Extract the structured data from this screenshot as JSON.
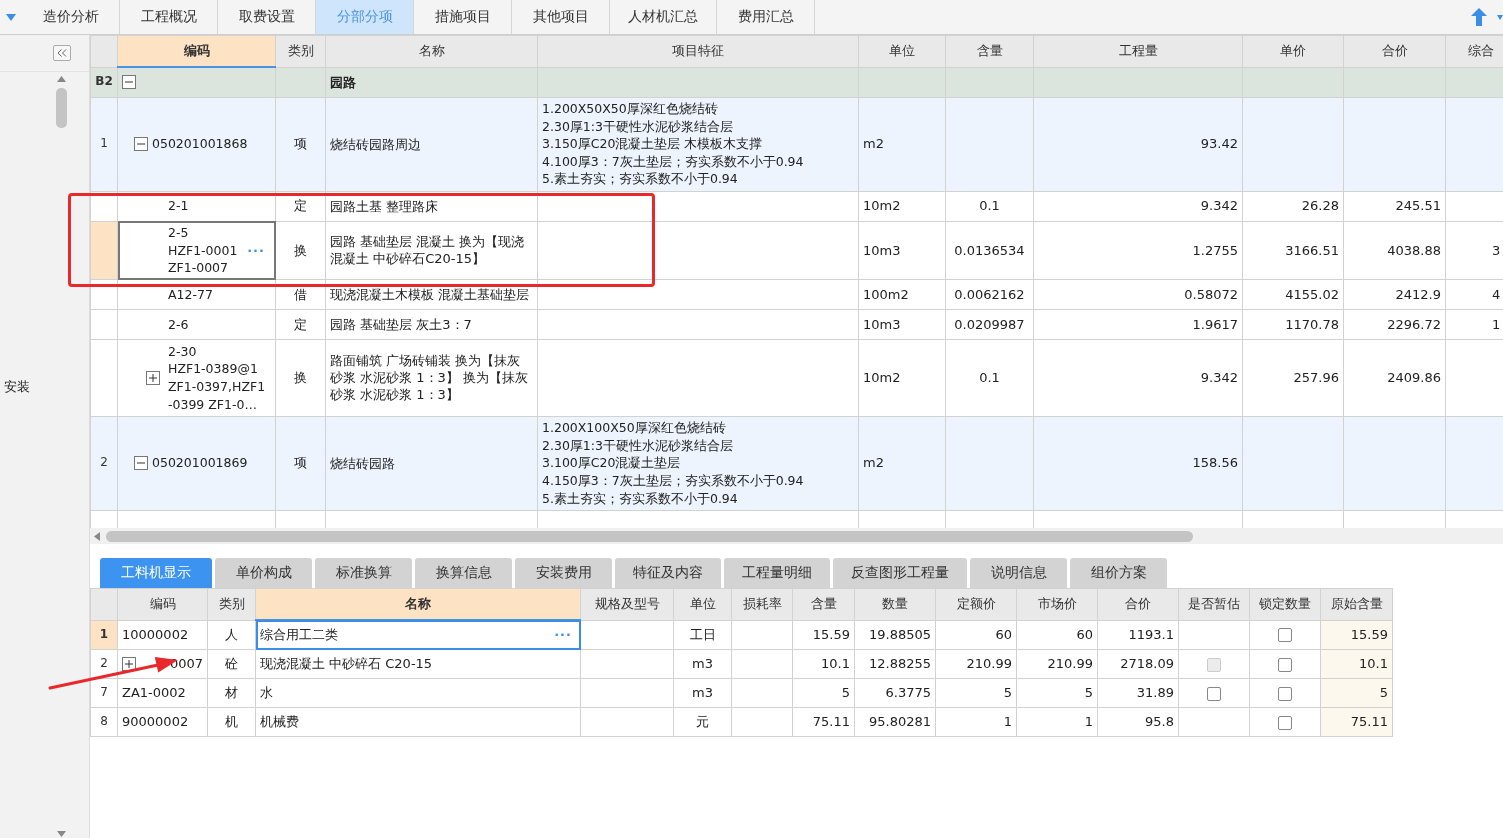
{
  "top_tabs": [
    {
      "label": "造价分析",
      "selected": false
    },
    {
      "label": "工程概况",
      "selected": false
    },
    {
      "label": "取费设置",
      "selected": false
    },
    {
      "label": "分部分项",
      "selected": true
    },
    {
      "label": "措施项目",
      "selected": false
    },
    {
      "label": "其他项目",
      "selected": false
    },
    {
      "label": "人材机汇总",
      "selected": false
    },
    {
      "label": "费用汇总",
      "selected": false
    }
  ],
  "side_panel": {
    "label": "安装"
  },
  "main_table": {
    "columns": [
      {
        "label": "编码",
        "selected": true
      },
      {
        "label": "类别",
        "selected": false
      },
      {
        "label": "名称",
        "selected": false
      },
      {
        "label": "项目特征",
        "selected": false
      },
      {
        "label": "单位",
        "selected": false
      },
      {
        "label": "含量",
        "selected": false
      },
      {
        "label": "工程量",
        "selected": false
      },
      {
        "label": "单价",
        "selected": false
      },
      {
        "label": "合价",
        "selected": false
      },
      {
        "label": "综合",
        "selected": false
      }
    ],
    "rows": [
      {
        "kind": "section",
        "number": "B2",
        "name": "园路",
        "expanded": true,
        "selected": false,
        "children": [
          {
            "kind": "item",
            "number": "1",
            "code": "050201001868",
            "type": "项",
            "name": "烧结砖园路周边",
            "features": "1.200X50X50厚深红色烧结砖\n2.30厚1:3干硬性水泥砂浆结合层\n3.150厚C20混凝土垫层 木模板木支撑\n4.100厚3：7灰土垫层；夯实系数不小于0.94\n5.素土夯实；夯实系数不小于0.94",
            "unit": "m2",
            "quantity": "93.42",
            "expanded": true,
            "selected": false,
            "children": [
              {
                "kind": "quota",
                "code": "2-1",
                "type": "定",
                "name": "园路土基 整理路床",
                "unit": "10m2",
                "content": "0.1",
                "quantity": "9.342",
                "unit_price": "26.28",
                "total_price": "245.51",
                "selected": false
              },
              {
                "kind": "quota",
                "code": "2-5\nHZF1-0001\nZF1-0007",
                "type": "换",
                "name": "园路 基础垫层 混凝土  换为【现浇混凝土 中砂碎石C20-15】",
                "unit": "10m3",
                "content": "0.0136534",
                "quantity": "1.2755",
                "unit_price": "3166.51",
                "total_price": "4038.88",
                "column_11": "3",
                "selected": true,
                "edit_button": "···"
              },
              {
                "kind": "quota",
                "code": "A12-77",
                "type": "借",
                "name": "现浇混凝土木模板 混凝土基础垫层",
                "unit": "100m2",
                "content": "0.0062162",
                "quantity": "0.58072",
                "unit_price": "4155.02",
                "total_price": "2412.9",
                "column_11": "4",
                "selected": false
              },
              {
                "kind": "quota",
                "code": "2-6",
                "type": "定",
                "name": "园路 基础垫层 灰土3：7",
                "unit": "10m3",
                "content": "0.0209987",
                "quantity": "1.9617",
                "unit_price": "1170.78",
                "total_price": "2296.72",
                "column_11": "1",
                "selected": false
              },
              {
                "kind": "quota",
                "code": "2-30\nHZF1-0389@1\nZF1-0397,HZF1\n-0399 ZF1-0…",
                "type": "换",
                "name": "路面铺筑 广场砖铺装  换为【抹灰砂浆 水泥砂浆 1：3】 换为【抹灰砂浆 水泥砂浆 1：3】",
                "unit": "10m2",
                "content": "0.1",
                "quantity": "9.342",
                "unit_price": "257.96",
                "total_price": "2409.86",
                "expanded": false,
                "selected": false
              }
            ]
          },
          {
            "kind": "item",
            "number": "2",
            "code": "050201001869",
            "type": "项",
            "name": "烧结砖园路",
            "features": "1.200X100X50厚深红色烧结砖\n2.30厚1:3干硬性水泥砂浆结合层\n3.100厚C20混凝土垫层\n4.150厚3：7灰土垫层；夯实系数不小于0.94\n5.素土夯实；夯实系数不小于0.94",
            "unit": "m2",
            "quantity": "158.56",
            "expanded": true,
            "selected": false
          }
        ]
      }
    ]
  },
  "detail_tabs": [
    {
      "label": "工料机显示",
      "selected": true
    },
    {
      "label": "单价构成",
      "selected": false
    },
    {
      "label": "标准换算",
      "selected": false
    },
    {
      "label": "换算信息",
      "selected": false
    },
    {
      "label": "安装费用",
      "selected": false
    },
    {
      "label": "特征及内容",
      "selected": false
    },
    {
      "label": "工程量明细",
      "selected": false
    },
    {
      "label": "反查图形工程量",
      "selected": false
    },
    {
      "label": "说明信息",
      "selected": false
    },
    {
      "label": "组价方案",
      "selected": false
    }
  ],
  "detail_table": {
    "columns": [
      {
        "label": "编码",
        "selected": false
      },
      {
        "label": "类别",
        "selected": false
      },
      {
        "label": "名称",
        "selected": true
      },
      {
        "label": "规格及型号",
        "selected": false
      },
      {
        "label": "单位",
        "selected": false
      },
      {
        "label": "损耗率",
        "selected": false
      },
      {
        "label": "含量",
        "selected": false
      },
      {
        "label": "数量",
        "selected": false
      },
      {
        "label": "定额价",
        "selected": false
      },
      {
        "label": "市场价",
        "selected": false
      },
      {
        "label": "合价",
        "selected": false
      },
      {
        "label": "是否暂估",
        "selected": false
      },
      {
        "label": "锁定数量",
        "selected": false
      },
      {
        "label": "原始含量",
        "selected": false
      }
    ],
    "rows": [
      {
        "number": "1",
        "code": "10000002",
        "type": "人",
        "name": "综合用工二类",
        "unit": "工日",
        "content": "15.59",
        "quantity": "19.88505",
        "quota_price": "60",
        "market_price": "60",
        "total": "1193.1",
        "locked": {
          "checked": false
        },
        "original_content": "15.59",
        "selected": true,
        "edit_button": "···"
      },
      {
        "number": "2",
        "code": "0007",
        "expanded": false,
        "type": "砼",
        "name": "现浇混凝土 中砂碎石 C20-15",
        "unit": "m3",
        "content": "10.1",
        "quantity": "12.88255",
        "quota_price": "210.99",
        "market_price": "210.99",
        "total": "2718.09",
        "temp_estimate": {
          "checked": false,
          "disabled": true
        },
        "locked": {
          "checked": false
        },
        "original_content": "10.1",
        "selected": false
      },
      {
        "number": "7",
        "code": "ZA1-0002",
        "type": "材",
        "name": "水",
        "unit": "m3",
        "content": "5",
        "quantity": "6.3775",
        "quota_price": "5",
        "market_price": "5",
        "total": "31.89",
        "temp_estimate": {
          "checked": false,
          "disabled": false
        },
        "locked": {
          "checked": false
        },
        "original_content": "5",
        "selected": false
      },
      {
        "number": "8",
        "code": "90000002",
        "type": "机",
        "name": "机械费",
        "unit": "元",
        "content": "75.11",
        "quantity": "95.80281",
        "quota_price": "1",
        "market_price": "1",
        "total": "95.8",
        "locked": {
          "checked": false
        },
        "original_content": "75.11",
        "selected": false
      }
    ]
  },
  "annotations": [
    {
      "kind": "rectangle"
    },
    {
      "kind": "arrow"
    }
  ]
}
